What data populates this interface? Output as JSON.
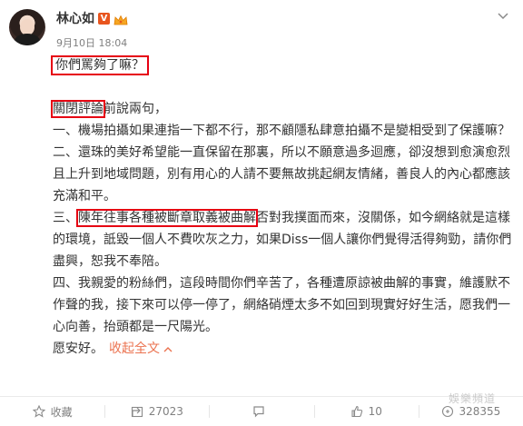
{
  "author": {
    "name": "林心如",
    "vip_badge": "V",
    "timestamp": "9月10日 18:04"
  },
  "post": {
    "line1": "你們罵夠了嘛？",
    "line2_boxed": "關閉評論",
    "line2_rest": "前說兩句，",
    "point1": "一、機場拍攝如果連指一下都不行，那不顧隱私肆意拍攝不是變相受到了保護嘛？",
    "point2": "二、還珠的美好希望能一直保留在那裏，所以不願意過多迴應，卻沒想到愈演愈烈且上升到地域問題，別有用心的人請不要無故挑起網友情緒，善良人的內心都應該充滿和平。",
    "point3_prefix": "三、",
    "point3_boxed": "陳年往事各種被斷章取義被曲解",
    "point3_rest": "否對我撲面而來，沒關係，如今網絡就是這樣的環境，詆毀一個人不費吹灰之力，如果Diss一個人讓你們覺得活得夠勁，請你們盡興，恕我不奉陪。",
    "point4": "四、我親愛的粉絲們，這段時間你們辛苦了，各種遭原諒被曲解的事實，維護默不作聲的我，接下來可以停一停了，網絡硝煙太多不如回到現實好好生活，愿我們一心向善，抬頭都是一尺陽光。",
    "signoff": "愿安好。",
    "expand_label": "收起全文"
  },
  "footer": {
    "favorite_label": "收藏",
    "share_count": "27023",
    "comment_count": "",
    "like_count": "10",
    "extra_count": "328355"
  },
  "watermark": "娛樂頻道",
  "colors": {
    "highlight_box": "#e60012",
    "link": "#eb7350",
    "timestamp": "#808080"
  }
}
